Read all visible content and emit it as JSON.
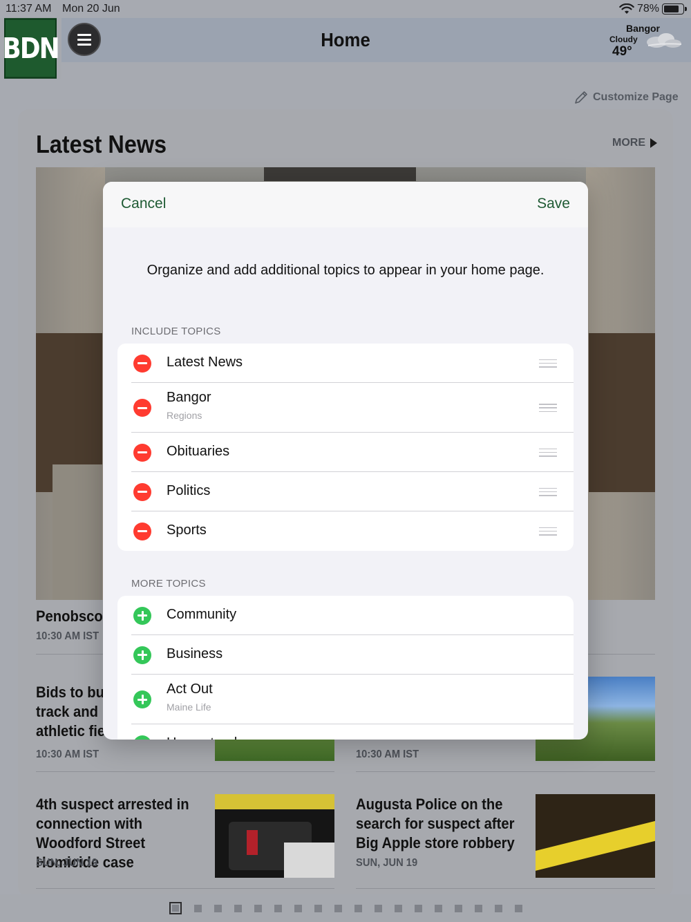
{
  "status": {
    "time": "11:37 AM",
    "date": "Mon 20 Jun",
    "battery": "78%",
    "battery_level": 0.78
  },
  "header": {
    "logo": "BDN",
    "title": "Home",
    "weather": {
      "city": "Bangor",
      "condition": "Cloudy",
      "temp": "49°"
    },
    "customize_label": "Customize Page"
  },
  "section": {
    "title": "Latest News",
    "more_label": "MORE"
  },
  "stories": [
    {
      "title": "Penobscot",
      "meta": "10:30 AM IST"
    },
    {
      "title": "Bids to bui\ntrack and \nathletic fie",
      "meta": "10:30 AM IST"
    },
    {
      "title": "",
      "meta": "10:30 AM IST"
    },
    {
      "title": "4th suspect arrested in connection with Woodford Street Homicide case",
      "meta": "SUN, JUN 19"
    },
    {
      "title": "Augusta Police on the search for suspect after Big Apple store robbery",
      "meta": "SUN, JUN 19"
    }
  ],
  "pager": {
    "count": 18,
    "active": 0
  },
  "modal": {
    "cancel_label": "Cancel",
    "save_label": "Save",
    "description": "Organize and add additional topics to appear in your home page.",
    "include_header": "INCLUDE TOPICS",
    "more_header": "MORE TOPICS",
    "include_topics": [
      {
        "label": "Latest News",
        "sub": ""
      },
      {
        "label": "Bangor",
        "sub": "Regions"
      },
      {
        "label": "Obituaries",
        "sub": ""
      },
      {
        "label": "Politics",
        "sub": ""
      },
      {
        "label": "Sports",
        "sub": ""
      }
    ],
    "more_topics": [
      {
        "label": "Community",
        "sub": ""
      },
      {
        "label": "Business",
        "sub": ""
      },
      {
        "label": "Act Out",
        "sub": "Maine Life"
      },
      {
        "label": "Homestead",
        "sub": ""
      }
    ]
  }
}
